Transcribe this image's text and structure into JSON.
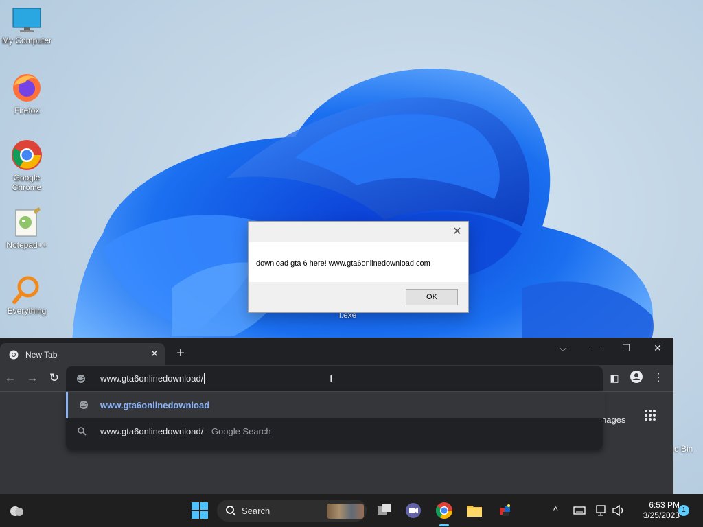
{
  "desktop": {
    "icons": [
      {
        "label": "My Computer"
      },
      {
        "label": "Firefox"
      },
      {
        "label": "Google Chrome"
      },
      {
        "label": "Notepad++"
      },
      {
        "label": "Everything"
      }
    ],
    "partial_labels": {
      "recycle_bin": "e Bin",
      "exe_file": "l.exe"
    }
  },
  "message_box": {
    "text": "download gta 6 here! www.gta6onlinedownload.com",
    "ok_label": "OK"
  },
  "browser": {
    "tab_title": "New Tab",
    "address_value": "www.gta6onlinedownload/",
    "suggestions": [
      {
        "text": "www.gta6onlinedownload",
        "suffix": "",
        "icon": "globe-icon"
      },
      {
        "text": "www.gta6onlinedownload/",
        "suffix": "- Google Search",
        "icon": "search-icon"
      }
    ],
    "ntp_partial": "nages"
  },
  "taskbar": {
    "search_label": "Search",
    "time": "6:53 PM",
    "date": "3/25/2023",
    "notifications": "1"
  },
  "colors": {
    "accent": "#8ab4f8",
    "taskbar": "#1f1f1f",
    "chrome_dark": "#202124"
  }
}
